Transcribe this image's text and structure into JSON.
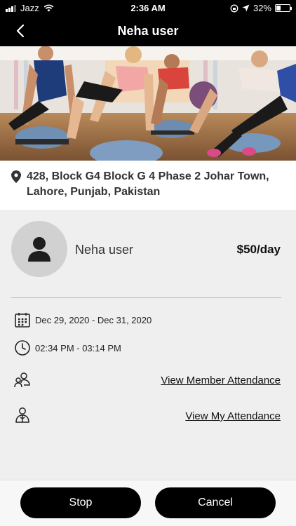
{
  "status_bar": {
    "carrier": "Jazz",
    "time": "2:36 AM",
    "battery": "32%",
    "battery_level": 0.32,
    "icons": [
      "signal-icon",
      "wifi-icon",
      "lock-rotation-icon",
      "location-arrow-icon",
      "battery-icon"
    ]
  },
  "header": {
    "title": "Neha user",
    "back_icon": "chevron-left-icon"
  },
  "hero": {
    "image": "fitness-class-photo"
  },
  "address": {
    "icon": "map-pin-icon",
    "text": "428, Block G4 Block G 4 Phase 2 Johar Town, Lahore, Punjab, Pakistan"
  },
  "member": {
    "name": "Neha user",
    "price": "$50/day",
    "avatar_icon": "person-icon"
  },
  "details": {
    "date_icon": "calendar-icon",
    "date_range": "Dec 29, 2020 - Dec 31, 2020",
    "time_icon": "clock-icon",
    "time_range": "02:34 PM - 03:14 PM",
    "members_icon": "group-icon",
    "member_attendance_link": "View Member Attendance",
    "trainer_icon": "trainer-icon",
    "my_attendance_link": "View My Attendance"
  },
  "actions": {
    "stop_label": "Stop",
    "cancel_label": "Cancel"
  }
}
